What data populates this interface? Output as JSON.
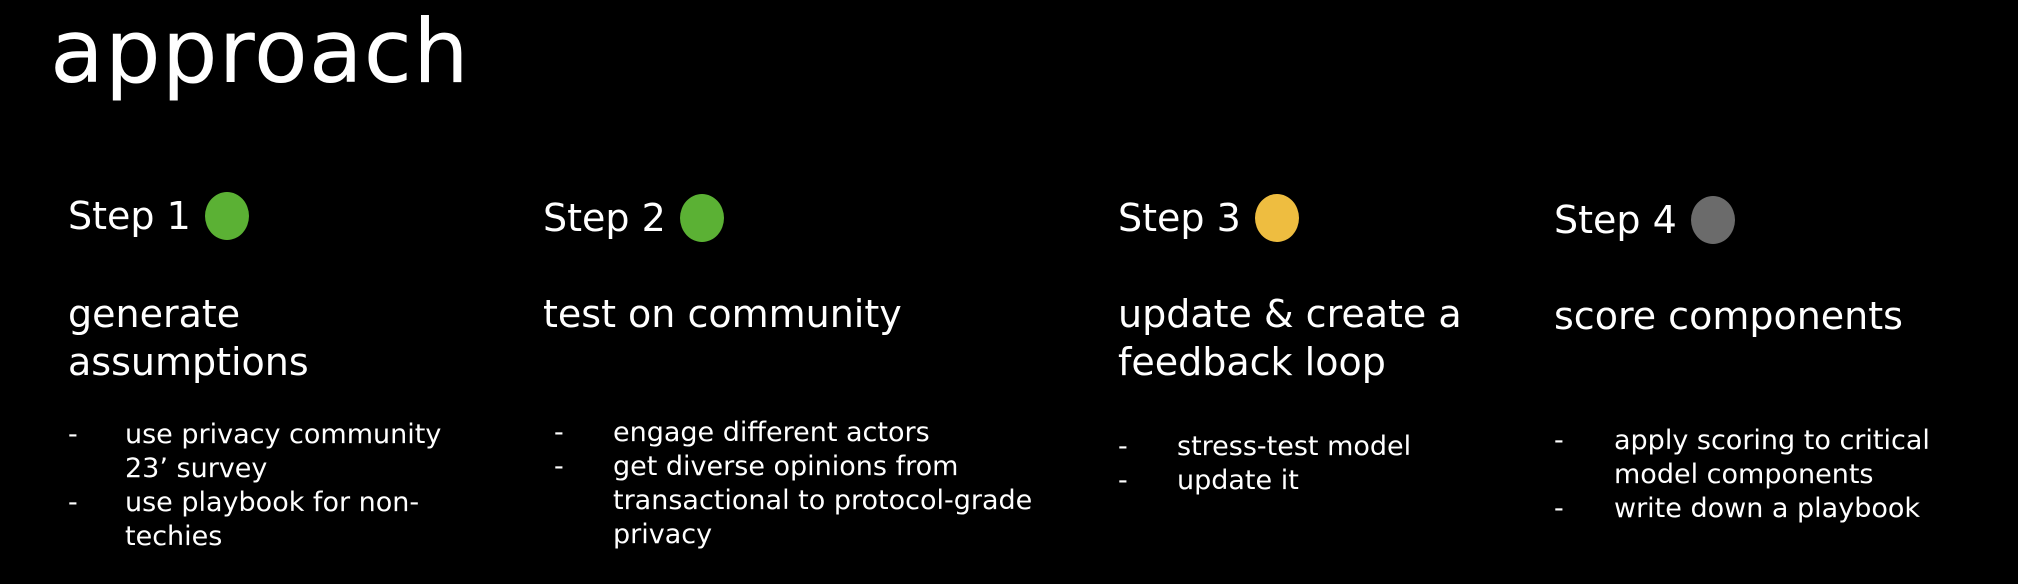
{
  "page": {
    "title": "approach"
  },
  "colors": {
    "background": "#000000",
    "text": "#ffffff",
    "done": "#5bb134",
    "in_progress": "#eebd40",
    "pending": "#6b6b6b"
  },
  "steps": [
    {
      "label": "Step 1",
      "status": "done",
      "status_color": "#5bb134",
      "heading_lines": [
        "generate",
        "assumptions"
      ],
      "bullets": [
        {
          "marker": "-",
          "lines": [
            "use privacy community",
            "23’ survey"
          ]
        },
        {
          "marker": "-",
          "lines": [
            "use playbook for non-",
            "techies"
          ]
        }
      ]
    },
    {
      "label": "Step 2",
      "status": "done",
      "status_color": "#5bb134",
      "heading_lines": [
        "test on community"
      ],
      "bullets": [
        {
          "marker": "-",
          "lines": [
            "engage different actors"
          ]
        },
        {
          "marker": "-",
          "lines": [
            "get diverse opinions from",
            "transactional to protocol-grade",
            "privacy"
          ]
        }
      ]
    },
    {
      "label": "Step 3",
      "status": "in-progress",
      "status_color": "#eebd40",
      "heading_lines": [
        "update & create a",
        "feedback loop"
      ],
      "bullets": [
        {
          "marker": "-",
          "lines": [
            "stress-test model"
          ]
        },
        {
          "marker": "-",
          "lines": [
            "update it"
          ]
        }
      ]
    },
    {
      "label": "Step 4",
      "status": "pending",
      "status_color": "#6b6b6b",
      "heading_lines": [
        "score components"
      ],
      "bullets": [
        {
          "marker": "-",
          "lines": [
            "apply scoring to critical",
            "model components"
          ]
        },
        {
          "marker": "-",
          "lines": [
            "write down a playbook"
          ]
        }
      ]
    }
  ]
}
